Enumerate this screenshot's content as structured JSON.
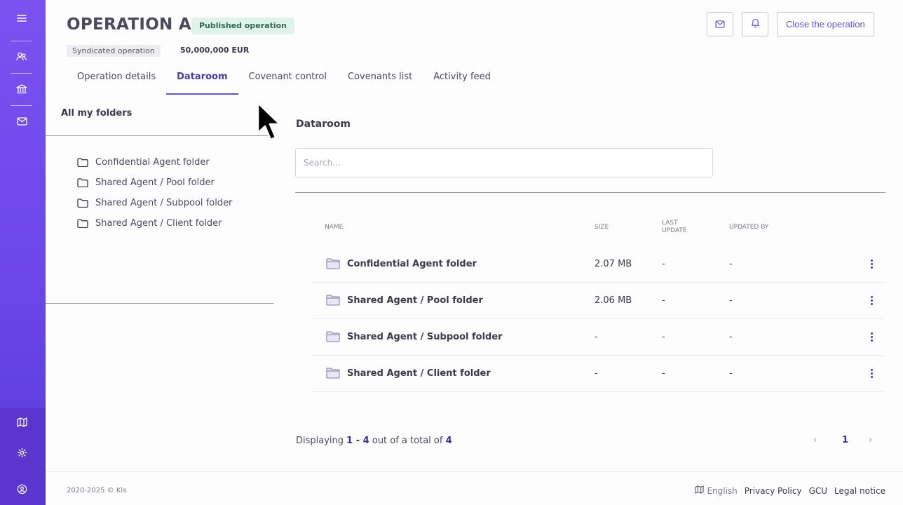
{
  "header": {
    "title": "OPERATION A",
    "status": "Published operation",
    "operation_type": "Syndicated operation",
    "amount": "50,000,000 EUR",
    "close_button": "Close the operation"
  },
  "tabs": [
    {
      "label": "Operation details"
    },
    {
      "label": "Dataroom"
    },
    {
      "label": "Covenant control"
    },
    {
      "label": "Covenants list"
    },
    {
      "label": "Activity feed"
    }
  ],
  "folders_panel": {
    "title": "All my folders",
    "items": [
      {
        "label": "Confidential Agent folder"
      },
      {
        "label": "Shared Agent / Pool folder"
      },
      {
        "label": "Shared Agent / Subpool folder"
      },
      {
        "label": "Shared Agent / Client folder"
      }
    ]
  },
  "dataroom": {
    "title": "Dataroom",
    "search_placeholder": "Search...",
    "columns": {
      "name": "NAME",
      "size": "SIZE",
      "last_update": "LAST UPDATE",
      "updated_by": "UPDATED BY"
    },
    "rows": [
      {
        "name": "Confidential Agent folder",
        "size": "2.07 MB",
        "last_update": "-",
        "updated_by": "-"
      },
      {
        "name": "Shared Agent / Pool folder",
        "size": "2.06 MB",
        "last_update": "-",
        "updated_by": "-"
      },
      {
        "name": "Shared Agent / Subpool folder",
        "size": "-",
        "last_update": "-",
        "updated_by": "-"
      },
      {
        "name": "Shared Agent / Client folder",
        "size": "-",
        "last_update": "-",
        "updated_by": "-"
      }
    ]
  },
  "pagination": {
    "prefix": "Displaying",
    "range": "1 - 4",
    "middle": "out of a total of",
    "total": "4",
    "current_page": "1"
  },
  "footer": {
    "copyright": "2020-2025 © Kls",
    "language": "English",
    "privacy": "Privacy Policy",
    "gcu": "GCU",
    "legal": "Legal notice"
  },
  "colors": {
    "sidebar": "#6a45e8",
    "accent": "#6a4fd4",
    "status_badge_bg": "#dff3ea"
  },
  "icons": {
    "sidebar": [
      "menu-icon",
      "users-icon",
      "bank-icon",
      "mail-icon",
      "map-icon",
      "gear-icon",
      "user-circle-icon"
    ],
    "header": [
      "mail-icon",
      "bell-icon"
    ],
    "folder": "folder-icon"
  }
}
